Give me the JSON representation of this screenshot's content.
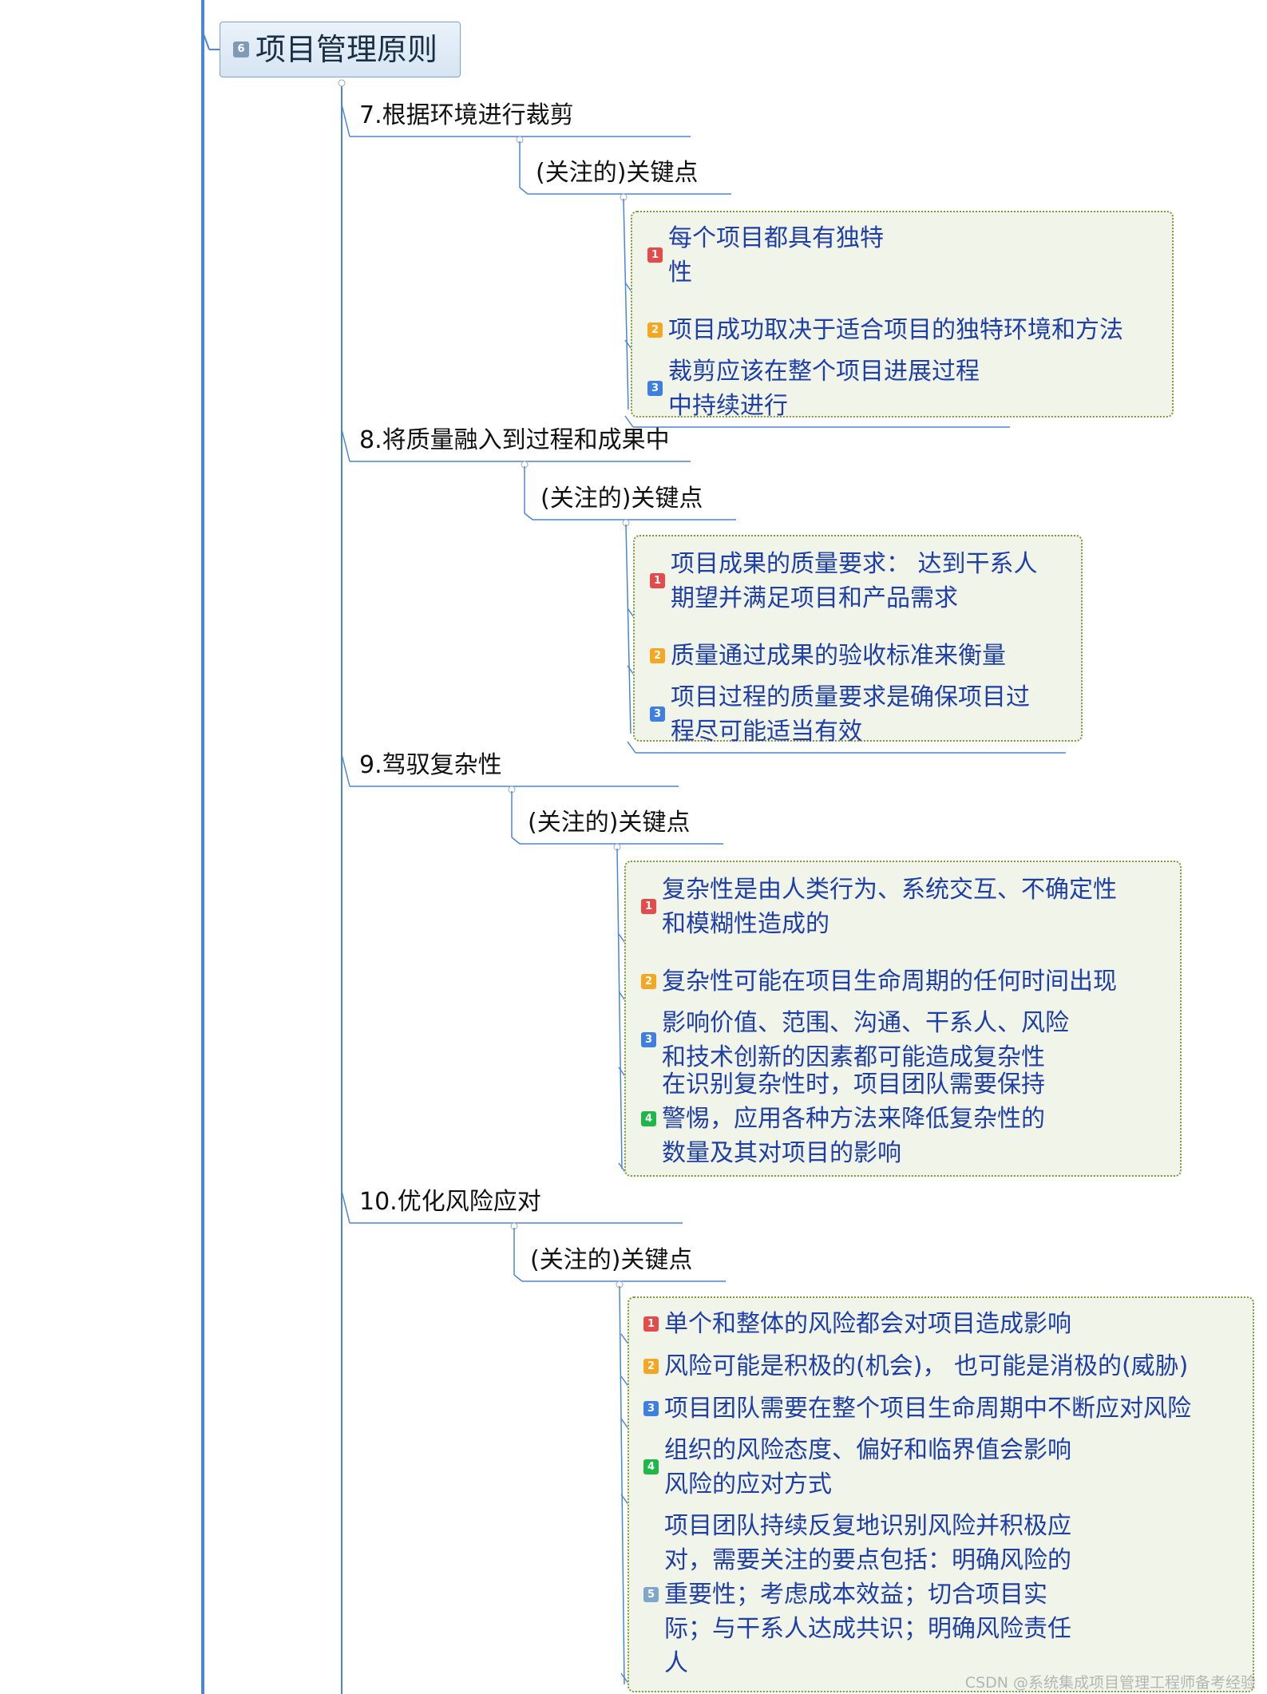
{
  "root": {
    "badge": "6",
    "title": "项目管理原则"
  },
  "principles": [
    {
      "label": "7.根据环境进行裁剪",
      "sub": "(关注的)关键点",
      "items": [
        {
          "badge": "1",
          "lines": [
            "每个项目都具有独特",
            "性"
          ]
        },
        {
          "badge": "2",
          "lines": [
            "项目成功取决于适合项目的独特环境和方法"
          ]
        },
        {
          "badge": "3",
          "lines": [
            "裁剪应该在整个项目进展过程",
            "中持续进行"
          ]
        }
      ]
    },
    {
      "label": "8.将质量融入到过程和成果中",
      "sub": "(关注的)关键点",
      "items": [
        {
          "badge": "1",
          "lines": [
            "项目成果的质量要求： 达到干系人",
            "期望并满足项目和产品需求"
          ]
        },
        {
          "badge": "2",
          "lines": [
            "质量通过成果的验收标准来衡量"
          ]
        },
        {
          "badge": "3",
          "lines": [
            "项目过程的质量要求是确保项目过",
            "程尽可能适当有效"
          ]
        }
      ]
    },
    {
      "label": "9.驾驭复杂性",
      "sub": "(关注的)关键点",
      "items": [
        {
          "badge": "1",
          "lines": [
            "复杂性是由人类行为、系统交互、不确定性",
            "和模糊性造成的"
          ]
        },
        {
          "badge": "2",
          "lines": [
            "复杂性可能在项目生命周期的任何时间出现"
          ]
        },
        {
          "badge": "3",
          "lines": [
            "影响价值、范围、沟通、干系人、风险",
            "和技术创新的因素都可能造成复杂性"
          ]
        },
        {
          "badge": "4",
          "lines": [
            "在识别复杂性时，项目团队需要保持",
            "警惕，应用各种方法来降低复杂性的",
            "数量及其对项目的影响"
          ]
        }
      ]
    },
    {
      "label": "10.优化风险应对",
      "sub": "(关注的)关键点",
      "items": [
        {
          "badge": "1",
          "lines": [
            "单个和整体的风险都会对项目造成影响"
          ]
        },
        {
          "badge": "2",
          "lines": [
            "风险可能是积极的(机会)， 也可能是消极的(威胁)"
          ]
        },
        {
          "badge": "3",
          "lines": [
            "项目团队需要在整个项目生命周期中不断应对风险"
          ]
        },
        {
          "badge": "4",
          "lines": [
            "组织的风险态度、偏好和临界值会影响",
            "风险的应对方式"
          ]
        },
        {
          "badge": "5",
          "lines": [
            "项目团队持续反复地识别风险并积极应",
            "对，需要关注的要点包括：明确风险的",
            "重要性；考虑成本效益；切合项目实",
            "际；与干系人达成共识；明确风险责任",
            "人"
          ]
        }
      ]
    }
  ],
  "watermark": "CSDN @系统集成项目管理工程师备考经验",
  "colors": {
    "branch_line": "#4a86d4",
    "item_text": "#1f3fa8",
    "group_fill": "#f1f4e9",
    "group_border": "#7f9a3b"
  }
}
